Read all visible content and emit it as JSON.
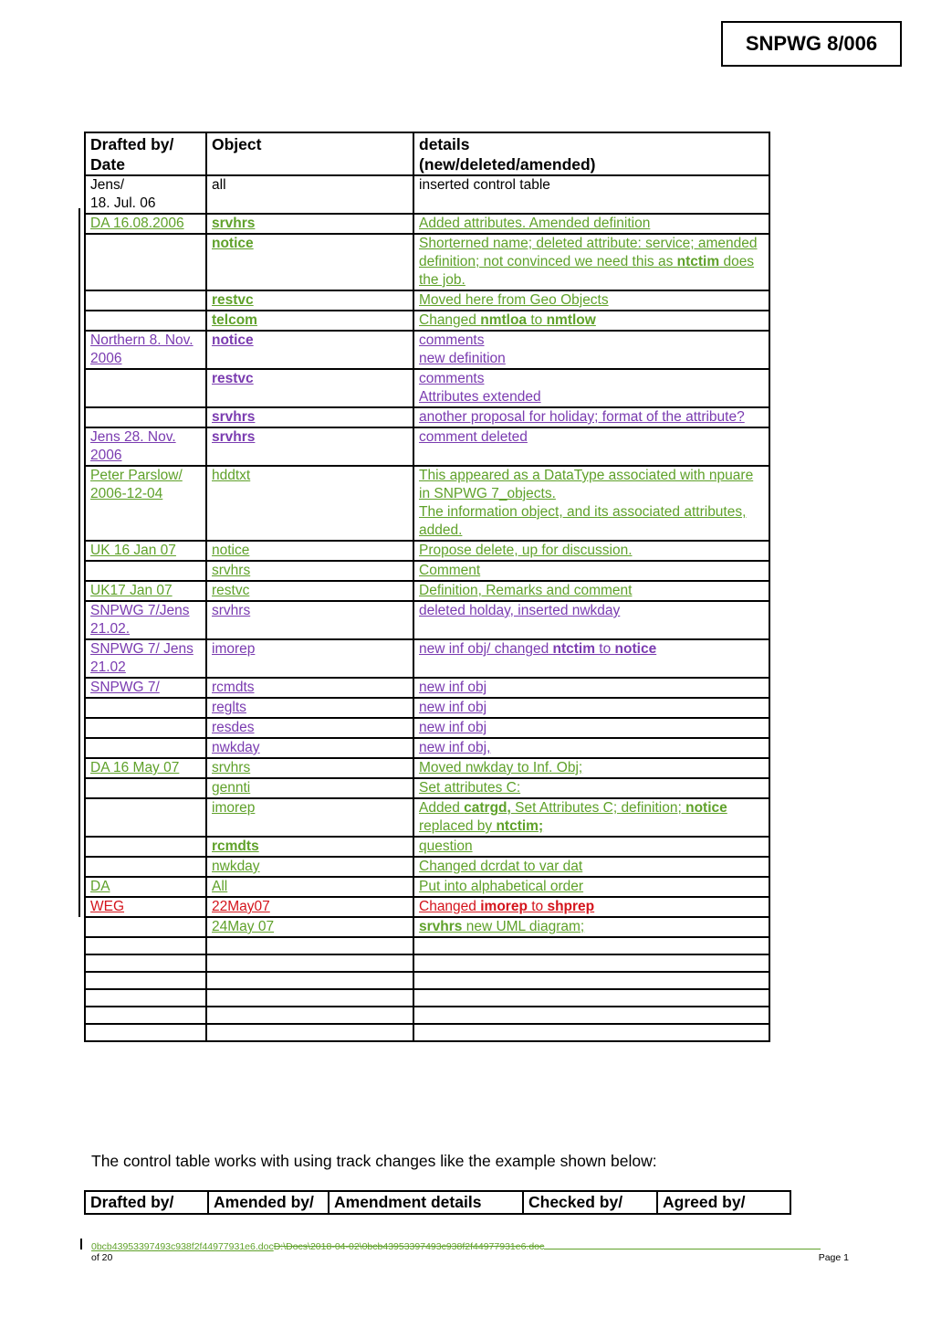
{
  "doc_id": "SNPWG 8/006",
  "control_table": {
    "headers": [
      "Drafted by/ Date",
      "Object",
      "details (new/deleted/amended)"
    ],
    "header_lines": {
      "col1": [
        "Drafted by/",
        "Date"
      ],
      "col2": [
        "Object"
      ],
      "col3": [
        "details",
        "(new/deleted/amended)"
      ]
    },
    "rows": [
      {
        "drafted": "Jens/\n18. Jul. 06",
        "object": "all",
        "details": "inserted control table",
        "color": "black"
      },
      {
        "drafted": "DA 16.08.2006",
        "object": "srvhrs",
        "object_bold": true,
        "details": "Added attributes.  Amended definition",
        "color": "green"
      },
      {
        "drafted": "",
        "object": "notice",
        "object_bold": true,
        "details_parts": [
          "Shorterned name; deleted attribute: service; amended definition; not convinced we need this as ",
          "ntctim",
          " does the job."
        ],
        "color": "green"
      },
      {
        "drafted": "",
        "object": "restvc",
        "object_bold": true,
        "details": "Moved here from Geo Objects",
        "color": "green"
      },
      {
        "drafted": "",
        "object": "telcom",
        "object_bold": true,
        "details_parts": [
          "Changed ",
          "nmtloa",
          " to ",
          "nmtlow"
        ],
        "color": "green"
      },
      {
        "drafted": "Northern 8. Nov. 2006",
        "object": "notice",
        "object_bold": true,
        "details": "comments\nnew definition",
        "color": "purple"
      },
      {
        "drafted": "",
        "object": "restvc",
        "object_bold": true,
        "details": "comments\nAttributes extended",
        "color": "purple"
      },
      {
        "drafted": "",
        "object": "srvhrs",
        "object_bold": true,
        "details": "another proposal for holiday; format of the attribute?",
        "color": "purple"
      },
      {
        "drafted": "Jens 28. Nov. 2006",
        "object": "srvhrs",
        "object_bold": true,
        "details": "comment deleted",
        "color": "purple"
      },
      {
        "drafted": "Peter Parslow/ 2006-12-04",
        "object": "hddtxt",
        "details": "This appeared as a DataType associated with npuare in SNPWG 7_objects.\nThe information object, and its associated attributes, added.",
        "color": "green"
      },
      {
        "drafted": "UK 16 Jan 07",
        "object": "notice",
        "details": "Propose delete, up for discussion.",
        "color": "green"
      },
      {
        "drafted": "",
        "object": "srvhrs",
        "details": "Comment",
        "color": "green"
      },
      {
        "drafted": "UK17 Jan 07",
        "object": "restvc",
        "details": "Definition, Remarks and comment",
        "color": "green"
      },
      {
        "drafted": "SNPWG 7/Jens 21.02.",
        "object": "srvhrs",
        "details": "deleted holday, inserted nwkday",
        "color": "purple"
      },
      {
        "drafted": "SNPWG 7/ Jens 21.02",
        "object": "imorep",
        "details_parts": [
          "new inf obj/ changed ",
          "ntctim",
          " to ",
          "notice"
        ],
        "color": "purple"
      },
      {
        "drafted": "SNPWG 7/",
        "object": "rcmdts",
        "details": "new inf obj",
        "color": "purple"
      },
      {
        "drafted": "",
        "object": "reglts",
        "details": "new inf obj",
        "color": "purple"
      },
      {
        "drafted": "",
        "object": "resdes",
        "details": "new inf obj",
        "color": "purple"
      },
      {
        "drafted": "",
        "object": "nwkday",
        "details": "new inf obj,",
        "color": "purple"
      },
      {
        "drafted": "DA 16 May 07",
        "object": "srvhrs",
        "details": "Moved nwkday to Inf. Obj;",
        "color": "green"
      },
      {
        "drafted": "",
        "object": "gennti",
        "details": "Set attributes C:",
        "color": "green"
      },
      {
        "drafted": "",
        "object": "imorep",
        "details_parts": [
          "Added ",
          "catrgd,",
          "  Set Attributes C; definition; ",
          "notice",
          " replaced by ",
          "ntctim;"
        ],
        "color": "green"
      },
      {
        "drafted": "",
        "object": "rcmdts",
        "object_bold": true,
        "details": "question",
        "color": "green"
      },
      {
        "drafted": "",
        "object": "nwkday",
        "details": "Changed dcrdat to var dat",
        "color": "green"
      },
      {
        "drafted": "DA",
        "object": "All",
        "details": "Put into alphabetical order",
        "color": "green"
      },
      {
        "drafted": "WEG",
        "object": "22May07",
        "details_parts": [
          "Changed ",
          "imorep",
          " to ",
          "shprep"
        ],
        "color": "red"
      },
      {
        "drafted": "",
        "object": "24May 07",
        "details_parts": [
          "srvhrs",
          " new UML diagram;"
        ],
        "color": "green"
      }
    ],
    "empty_rows": 6
  },
  "intro_text": "The control table works with using track changes like the example shown below:",
  "example_table": {
    "headers": [
      "Drafted by/",
      "Amended by/",
      "Amendment details",
      "Checked by/",
      "Agreed by/"
    ]
  },
  "footer": {
    "filename": "0bcb43953397493c938f2f44977931e6.doc",
    "deleted_path": "D:\\Docs\\2018-04-02\\0bcb43953397493c938f2f44977931e6.doc",
    "page_label": "Page 1",
    "of_label": "of 20"
  },
  "colors": {
    "insert_green": "#5fa12a",
    "insert_purple": "#7a3bb0",
    "insert_red": "#d4141c"
  }
}
